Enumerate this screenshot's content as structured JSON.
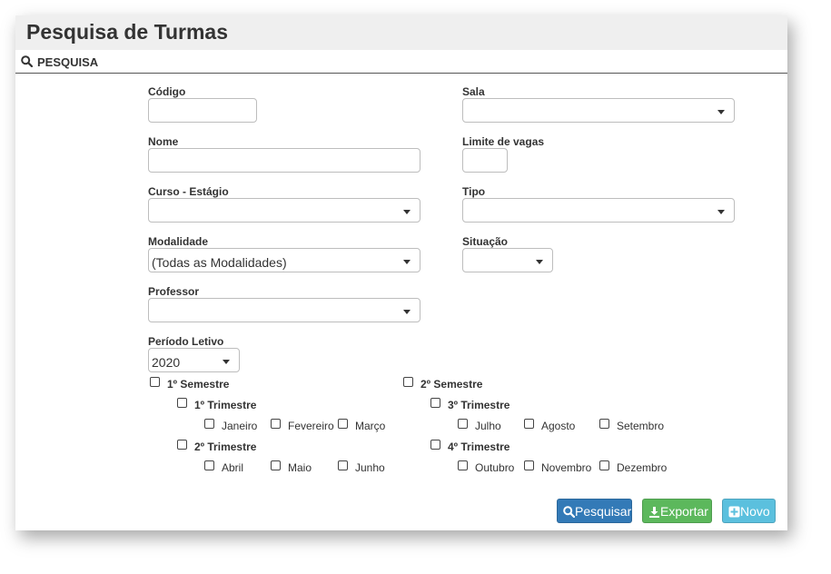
{
  "page": {
    "title": "Pesquisa de Turmas"
  },
  "section": {
    "title": "PESQUISA",
    "icon": "search-icon"
  },
  "form": {
    "codigo_label": "Código",
    "codigo_value": "",
    "sala_label": "Sala",
    "sala_value": "",
    "nome_label": "Nome",
    "nome_value": "",
    "limite_label": "Limite de vagas",
    "limite_value": "",
    "curso_label": "Curso - Estágio",
    "curso_value": "",
    "tipo_label": "Tipo",
    "tipo_value": "",
    "modalidade_label": "Modalidade",
    "modalidade_value": "(Todas as Modalidades)",
    "situacao_label": "Situação",
    "situacao_value": "",
    "professor_label": "Professor",
    "professor_value": "",
    "periodo_label": "Período Letivo",
    "periodo_value": "2020"
  },
  "periods": {
    "sem1": "1º Semestre",
    "sem2": "2º Semestre",
    "tri1": "1º Trimestre",
    "tri2": "2º Trimestre",
    "tri3": "3º Trimestre",
    "tri4": "4º Trimestre",
    "months": [
      "Janeiro",
      "Fevereiro",
      "Março",
      "Abril",
      "Maio",
      "Junho",
      "Julho",
      "Agosto",
      "Setembro",
      "Outubro",
      "Novembro",
      "Dezembro"
    ]
  },
  "buttons": {
    "pesquisar": "Pesquisar",
    "exportar": "Exportar",
    "novo": "Novo",
    "colors": {
      "pesquisar": "#337ab7",
      "exportar": "#5cb85c",
      "novo": "#5bc0de"
    }
  }
}
